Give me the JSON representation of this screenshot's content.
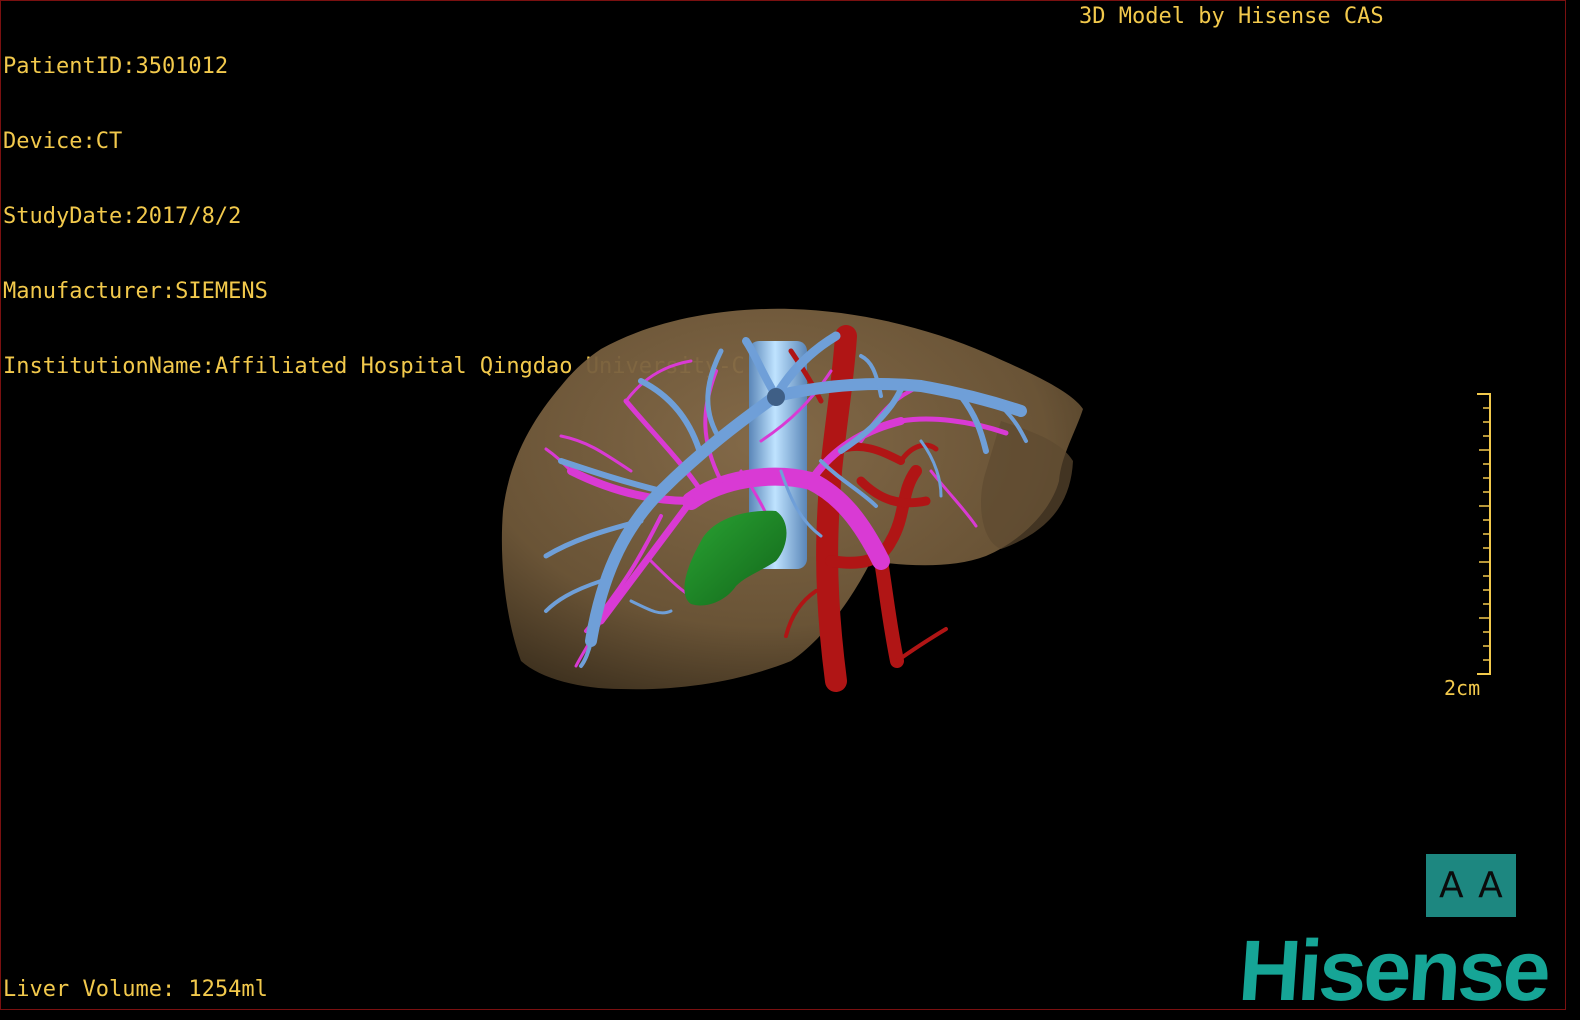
{
  "patient_info": {
    "patient_id": "PatientID:3501012",
    "device": "Device:CT",
    "study_date": "StudyDate:2017/8/2",
    "manufacturer": "Manufacturer:SIEMENS",
    "institution": "InstitutionName:Affiliated Hospital Qingdao University-C"
  },
  "model_credit": "3D Model by Hisense CAS",
  "liver_volume": "Liver Volume: 1254ml",
  "scale": {
    "label": "2cm"
  },
  "orientation": {
    "left_letter": "A",
    "right_letter": "A"
  },
  "brand_logo": "Hisense",
  "colors": {
    "overlay_text": "#f2c94c",
    "liver": "#7a6244",
    "hepatic_vein": "#6f9fd8",
    "portal_vein": "#d93ad4",
    "artery": "#b01515",
    "gallbladder": "#1e8c26",
    "ivc": "#8fc7f0",
    "orientation_bg": "#1d8780",
    "brand": "#16a596"
  }
}
